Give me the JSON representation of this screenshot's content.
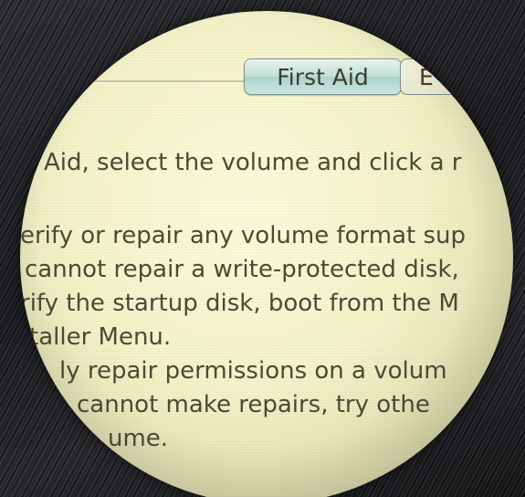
{
  "tabs": {
    "first_aid": "First Aid",
    "next_partial": "E"
  },
  "body_lines": [
    "Aid, select the volume and click a r",
    "erify or repair any volume format sup",
    "cannot repair a write-protected disk,",
    "rify the startup disk, boot from the M",
    "taller Menu.",
    "ly repair permissions on a volum",
    "cannot make repairs, try othe",
    "ume."
  ]
}
